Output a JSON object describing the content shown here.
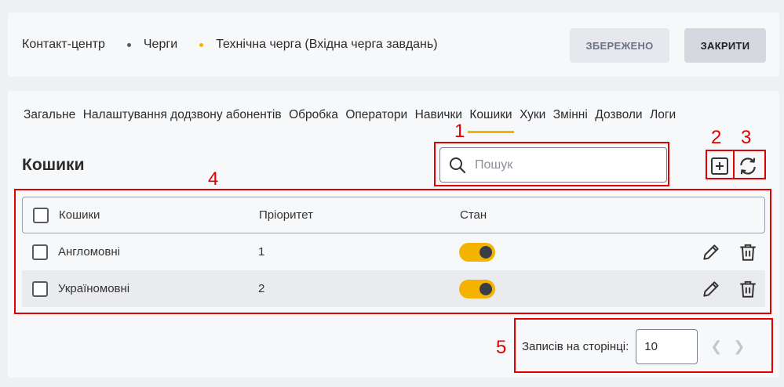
{
  "header": {
    "breadcrumb": [
      "Контакт-центр",
      "Черги",
      "Технічна черга (Вхідна черга завдань)"
    ],
    "dot_colors": [
      "#555a66",
      "#f5b301"
    ],
    "saved_label": "ЗБЕРЕЖЕНО",
    "close_label": "ЗАКРИТИ"
  },
  "tabs": [
    "Загальне",
    "Налаштування додзвону абонентів",
    "Обробка",
    "Оператори",
    "Навички",
    "Кошики",
    "Хуки",
    "Змінні",
    "Дозволи",
    "Логи"
  ],
  "active_tab": "Кошики",
  "section": {
    "title": "Кошики",
    "search_placeholder": "Пошук",
    "add_icon": "plus-square-icon",
    "refresh_icon": "refresh-icon"
  },
  "table": {
    "columns": [
      "Кошики",
      "Пріоритет",
      "Стан"
    ],
    "rows": [
      {
        "name": "Англомовні",
        "priority": "1",
        "enabled": true
      },
      {
        "name": "Україномовні",
        "priority": "2",
        "enabled": true
      }
    ]
  },
  "pagination": {
    "label": "Записів на сторінці:",
    "page_size": "10"
  },
  "annotations": [
    "1",
    "2",
    "3",
    "4",
    "5"
  ],
  "colors": {
    "accent": "#f5b301",
    "annotation": "#e00000"
  }
}
